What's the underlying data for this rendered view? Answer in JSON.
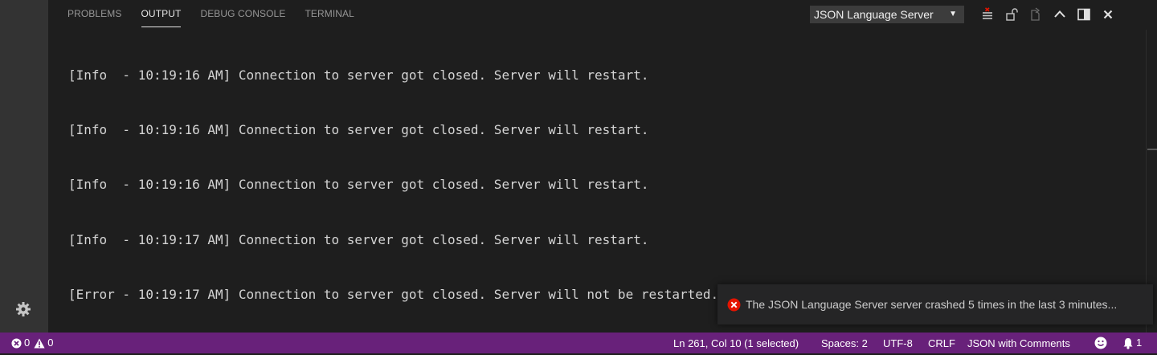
{
  "panel": {
    "tabs": [
      "PROBLEMS",
      "OUTPUT",
      "DEBUG CONSOLE",
      "TERMINAL"
    ],
    "active_tab": "OUTPUT",
    "channel": {
      "selected": "JSON Language Server",
      "arrow": "▼"
    },
    "actions": [
      "clear-output-icon",
      "lock-scroll-icon",
      "open-log-file-icon",
      "maximize-panel-icon",
      "toggle-panel-position-icon",
      "close-panel-icon"
    ]
  },
  "output": {
    "lines": [
      "[Info  - 10:19:16 AM] Connection to server got closed. Server will restart.",
      "[Info  - 10:19:16 AM] Connection to server got closed. Server will restart.",
      "[Info  - 10:19:16 AM] Connection to server got closed. Server will restart.",
      "[Info  - 10:19:17 AM] Connection to server got closed. Server will restart.",
      "[Error - 10:19:17 AM] Connection to server got closed. Server will not be restarted."
    ]
  },
  "notification": {
    "icon": "error-icon",
    "message": "The JSON Language Server server crashed 5 times in the last 3 minutes..."
  },
  "status_bar": {
    "errors": "0",
    "warnings": "0",
    "cursor": "Ln 261, Col 10 (1 selected)",
    "indent": "Spaces: 2",
    "encoding": "UTF-8",
    "eol": "CRLF",
    "language": "JSON with Comments",
    "notifications": "1"
  },
  "colors": {
    "status_bar": "#68217a",
    "panel_bg": "#1e1e1e",
    "activity_bar": "#333333",
    "error": "#e51400"
  }
}
